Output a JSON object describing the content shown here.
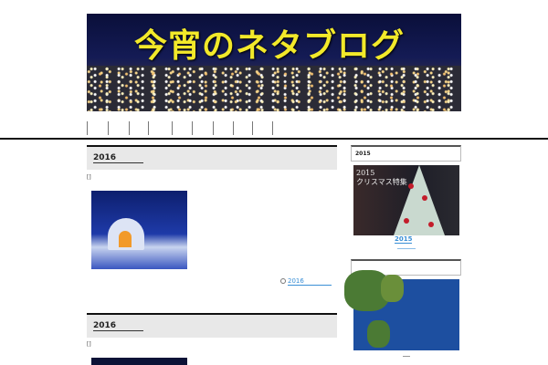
{
  "header": {
    "site_title": "今宵のネタブログ"
  },
  "posts": [
    {
      "title": "2016",
      "meta": "[]",
      "more_label": "2016"
    },
    {
      "title": "2016",
      "meta": "[]"
    }
  ],
  "sidebar": {
    "widgets": [
      {
        "title": "2015",
        "image_caption": "2015\nクリスマス特集",
        "link": "2015"
      },
      {
        "title": ""
      }
    ]
  },
  "colors": {
    "title_yellow": "#f2e92a",
    "link": "#3a8fd6"
  }
}
